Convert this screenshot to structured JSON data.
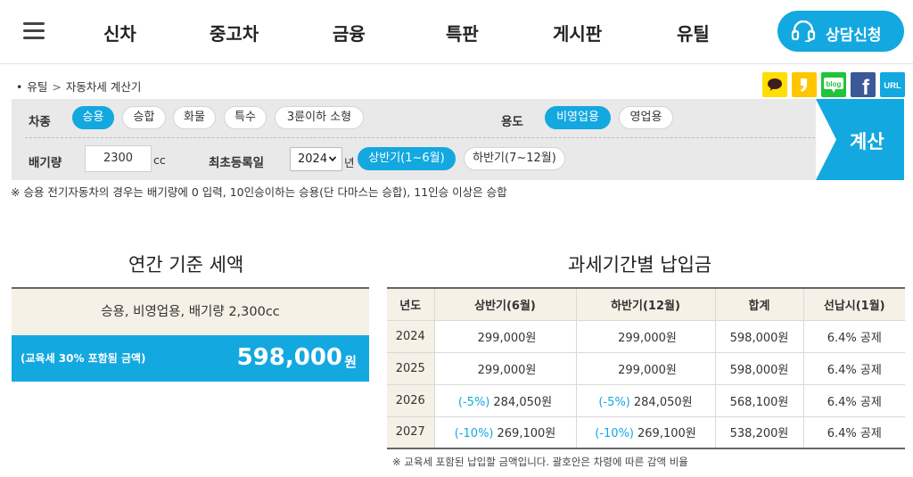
{
  "nav": {
    "menu": [
      "신차",
      "중고차",
      "금융",
      "특판",
      "게시판",
      "유틸"
    ],
    "consult_label": "상담신청",
    "accent": "#13a8e0"
  },
  "breadcrumb": {
    "parent": "유틸",
    "separator": ">",
    "current": "자동차세 계산기"
  },
  "share": {
    "items": [
      {
        "icon": "kakaotalk-icon",
        "color": "#ffde00"
      },
      {
        "icon": "kakaostory-icon",
        "color": "#ffc600"
      },
      {
        "icon": "blog-icon",
        "label": "blog",
        "color": "#1fc43a"
      },
      {
        "icon": "facebook-icon",
        "label": "f",
        "color": "#3b5998"
      },
      {
        "icon": "url-icon",
        "label": "URL",
        "color": "#13a8e0"
      }
    ]
  },
  "form": {
    "vehicle_type": {
      "label": "차종",
      "options": [
        "승용",
        "승합",
        "화물",
        "특수",
        "3륜이하 소형"
      ],
      "selected": "승용"
    },
    "usage": {
      "label": "용도",
      "options": [
        "비영업용",
        "영업용"
      ],
      "selected": "비영업용"
    },
    "displacement": {
      "label": "배기량",
      "value": "2300",
      "unit": "cc"
    },
    "registration": {
      "label": "최초등록일",
      "year": "2024",
      "year_unit": "년",
      "half_options": [
        "상반기(1~6월)",
        "하반기(7~12월)"
      ],
      "selected_half": "상반기(1~6월)"
    },
    "calc_label": "계산",
    "notice": "※ 승용 전기자동차의 경우는 배기량에 0 입력, 10인승이하는 승용(단 다마스는 승합), 11인승 이상은 승합"
  },
  "annual": {
    "title": "연간 기준 세액",
    "summary": "승용, 비영업용, 배기량 2,300cc",
    "note": "(교육세 30% 포함됨 금액)",
    "amount": "598,000",
    "unit": "원"
  },
  "periodic": {
    "title": "과세기간별 납입금",
    "headers": [
      "년도",
      "상반기(6월)",
      "하반기(12월)",
      "합계",
      "선납시(1월)"
    ],
    "rows": [
      {
        "year": "2024",
        "first_disc": "",
        "first": "299,000원",
        "second_disc": "",
        "second": "299,000원",
        "total": "598,000원",
        "prepay": "6.4% 공제"
      },
      {
        "year": "2025",
        "first_disc": "",
        "first": "299,000원",
        "second_disc": "",
        "second": "299,000원",
        "total": "598,000원",
        "prepay": "6.4% 공제"
      },
      {
        "year": "2026",
        "first_disc": "(-5%)",
        "first": "284,050원",
        "second_disc": "(-5%)",
        "second": "284,050원",
        "total": "568,100원",
        "prepay": "6.4% 공제"
      },
      {
        "year": "2027",
        "first_disc": "(-10%)",
        "first": "269,100원",
        "second_disc": "(-10%)",
        "second": "269,100원",
        "total": "538,200원",
        "prepay": "6.4% 공제"
      }
    ],
    "footnote": "※ 교육세 포함된 납입할 금액입니다. 괄호안은 차령에 따른 감액 비율"
  }
}
